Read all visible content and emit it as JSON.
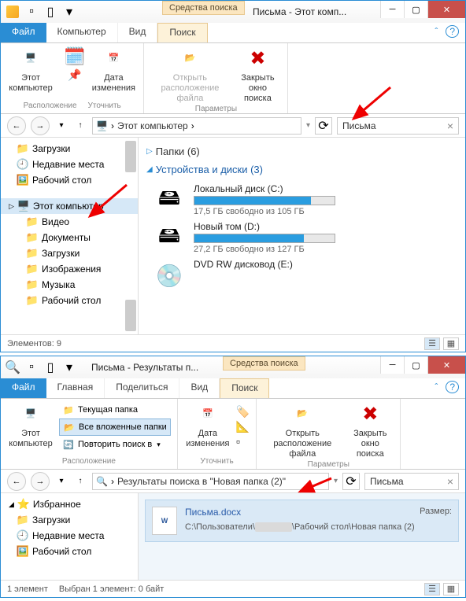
{
  "w1": {
    "searchToolsLabel": "Средства поиска",
    "title": "Письма - Этот комп...",
    "tabs": {
      "file": "Файл",
      "computer": "Компьютер",
      "view": "Вид",
      "search": "Поиск"
    },
    "ribbon": {
      "group1": {
        "label": "Расположение",
        "thisPC": "Этот компьютер",
        "date": "Дата изменения",
        "dateSub": "Уточнить"
      },
      "group2": {
        "label": "Параметры",
        "open": "Открыть расположение файла",
        "close": "Закрыть окно поиска"
      }
    },
    "address": {
      "crumb": "Этот компьютер"
    },
    "search": {
      "value": "Письма"
    },
    "tree": {
      "downloads": "Загрузки",
      "recent": "Недавние места",
      "desktop": "Рабочий стол",
      "thisPC": "Этот компьютер",
      "videos": "Видео",
      "documents": "Документы",
      "downloads2": "Загрузки",
      "pictures": "Изображения",
      "music": "Музыка",
      "desktop2": "Рабочий стол"
    },
    "content": {
      "folders": "Папки (6)",
      "devices": "Устройства и диски (3)",
      "driveC": {
        "name": "Локальный диск (C:)",
        "free": "17,5 ГБ свободно из 105 ГБ",
        "fillPct": 83
      },
      "driveD": {
        "name": "Новый том (D:)",
        "free": "27,2 ГБ свободно из 127 ГБ",
        "fillPct": 78
      },
      "dvd": "DVD RW дисковод (E:)"
    },
    "status": "Элементов: 9"
  },
  "w2": {
    "searchToolsLabel": "Средства поиска",
    "title": "Письма - Результаты п...",
    "tabs": {
      "file": "Файл",
      "home": "Главная",
      "share": "Поделиться",
      "view": "Вид",
      "search": "Поиск"
    },
    "ribbon": {
      "group1": {
        "label": "Расположение",
        "thisPC": "Этот компьютер",
        "currentFolder": "Текущая папка",
        "allSub": "Все вложенные папки",
        "repeat": "Повторить поиск в"
      },
      "group2": {
        "label": "Уточнить",
        "date": "Дата изменения"
      },
      "group3": {
        "label": "Параметры",
        "open": "Открыть расположение файла",
        "close": "Закрыть окно поиска"
      }
    },
    "address": {
      "crumb": "Результаты поиска в \"Новая папка (2)\""
    },
    "search": {
      "value": "Письма"
    },
    "tree": {
      "favorites": "Избранное",
      "downloads": "Загрузки",
      "recent": "Недавние места",
      "desktop": "Рабочий стол"
    },
    "result": {
      "name": "Письма.docx",
      "sizeLabel": "Размер:",
      "path": "C:\\Пользователи\\            \\Рабочий стол\\Новая папка (2)"
    },
    "status": {
      "count": "1 элемент",
      "selected": "Выбран 1 элемент: 0 байт"
    }
  }
}
